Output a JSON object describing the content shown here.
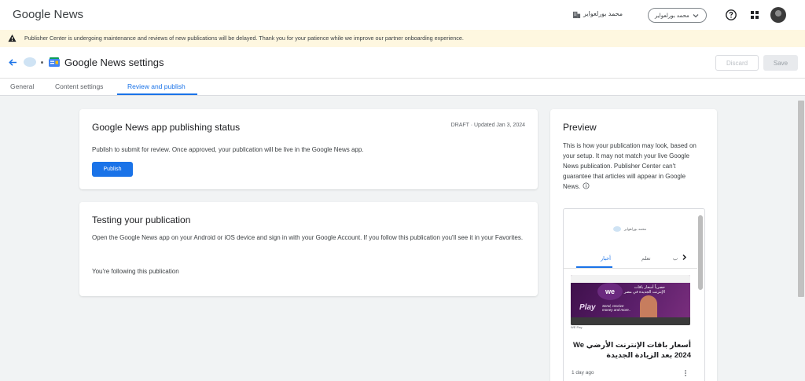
{
  "header": {
    "brand": "Google News",
    "org_name": "محمد بورلعواير",
    "account_name": "محمد بورلعواير",
    "help_icon": "help-circle-icon",
    "apps_icon": "apps-grid-icon"
  },
  "banner": {
    "message": "Publisher Center is undergoing maintenance and reviews of new publications will be delayed. Thank you for your patience while we improve our partner onboarding experience."
  },
  "page": {
    "title": "Google News settings",
    "discard_label": "Discard",
    "save_label": "Save"
  },
  "tabs": [
    {
      "label": "General",
      "active": false
    },
    {
      "label": "Content settings",
      "active": false
    },
    {
      "label": "Review and publish",
      "active": true
    }
  ],
  "publishing_card": {
    "title": "Google News app publishing status",
    "status": "DRAFT · Updated Jan 3, 2024",
    "description": "Publish to submit for review. Once approved, your publication will be live in the Google News app.",
    "publish_label": "Publish"
  },
  "testing_card": {
    "title": "Testing your publication",
    "description": "Open the Google News app on your Android or iOS device and sign in with your Google Account. If you follow this publication you'll see it in your Favorites.",
    "following_text": "You're following this publication"
  },
  "preview": {
    "title": "Preview",
    "description": "This is how your publication may look, based on your setup. It may not match your live Google News publication. Publisher Center can't guarantee that articles will appear in Google News.",
    "phone": {
      "publication_name": "محمد بورلعواير",
      "tabs": [
        "أخبار",
        "تعلم",
        "ب"
      ],
      "article": {
        "image_headline": "حصرياً أسعار باقات الإنترنت الجديدة في مصر",
        "image_logo_text": "we",
        "image_play_text": "Play",
        "image_tagline": "Send, receive money and more..",
        "source": "WE Pay",
        "title": "أسعار باقات الإنترنت الأرضي We 2024 بعد الزيادة الجديدة",
        "time": "1 day ago"
      }
    }
  }
}
